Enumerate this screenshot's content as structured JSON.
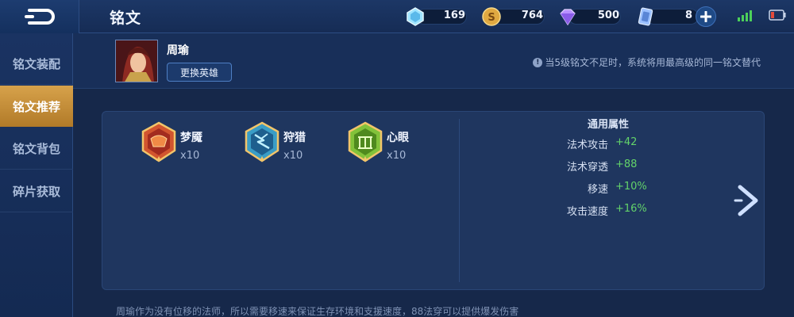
{
  "header": {
    "title": "铭文",
    "back_icon": "back-arrow-icon",
    "currencies": [
      {
        "name": "diamond",
        "value": "169",
        "color": "#7fd6ff"
      },
      {
        "name": "gold-coin",
        "value": "764",
        "color": "#e4b24a"
      },
      {
        "name": "purple-crystal",
        "value": "500",
        "color": "#b58cff"
      },
      {
        "name": "card-ticket",
        "value": "8",
        "color": "#8fb8ff"
      }
    ],
    "signal_icon": "signal-icon",
    "battery_icon": "battery-icon"
  },
  "sidebar": {
    "items": [
      {
        "label": "铭文装配",
        "active": false
      },
      {
        "label": "铭文推荐",
        "active": true
      },
      {
        "label": "铭文背包",
        "active": false
      },
      {
        "label": "碎片获取",
        "active": false
      }
    ]
  },
  "hero": {
    "name": "周瑜",
    "change_button": "更换英雄"
  },
  "notice": "当5级铭文不足时，系统将用最高级的同一铭文替代",
  "runes": [
    {
      "name": "梦魇",
      "count": "x10",
      "color": "#c4462c"
    },
    {
      "name": "狩猎",
      "count": "x10",
      "color": "#3aa4c9"
    },
    {
      "name": "心眼",
      "count": "x10",
      "color": "#7cbd36"
    }
  ],
  "attributes": {
    "title": "通用属性",
    "rows": [
      {
        "label": "法术攻击",
        "value": "+42"
      },
      {
        "label": "法术穿透",
        "value": "+88"
      },
      {
        "label": "移速",
        "value": "+10%"
      },
      {
        "label": "攻击速度",
        "value": "+16%"
      }
    ]
  },
  "description": "周瑜作为没有位移的法师，所以需要移速来保证生存环境和支援速度，88法穿可以提供爆发伤害"
}
